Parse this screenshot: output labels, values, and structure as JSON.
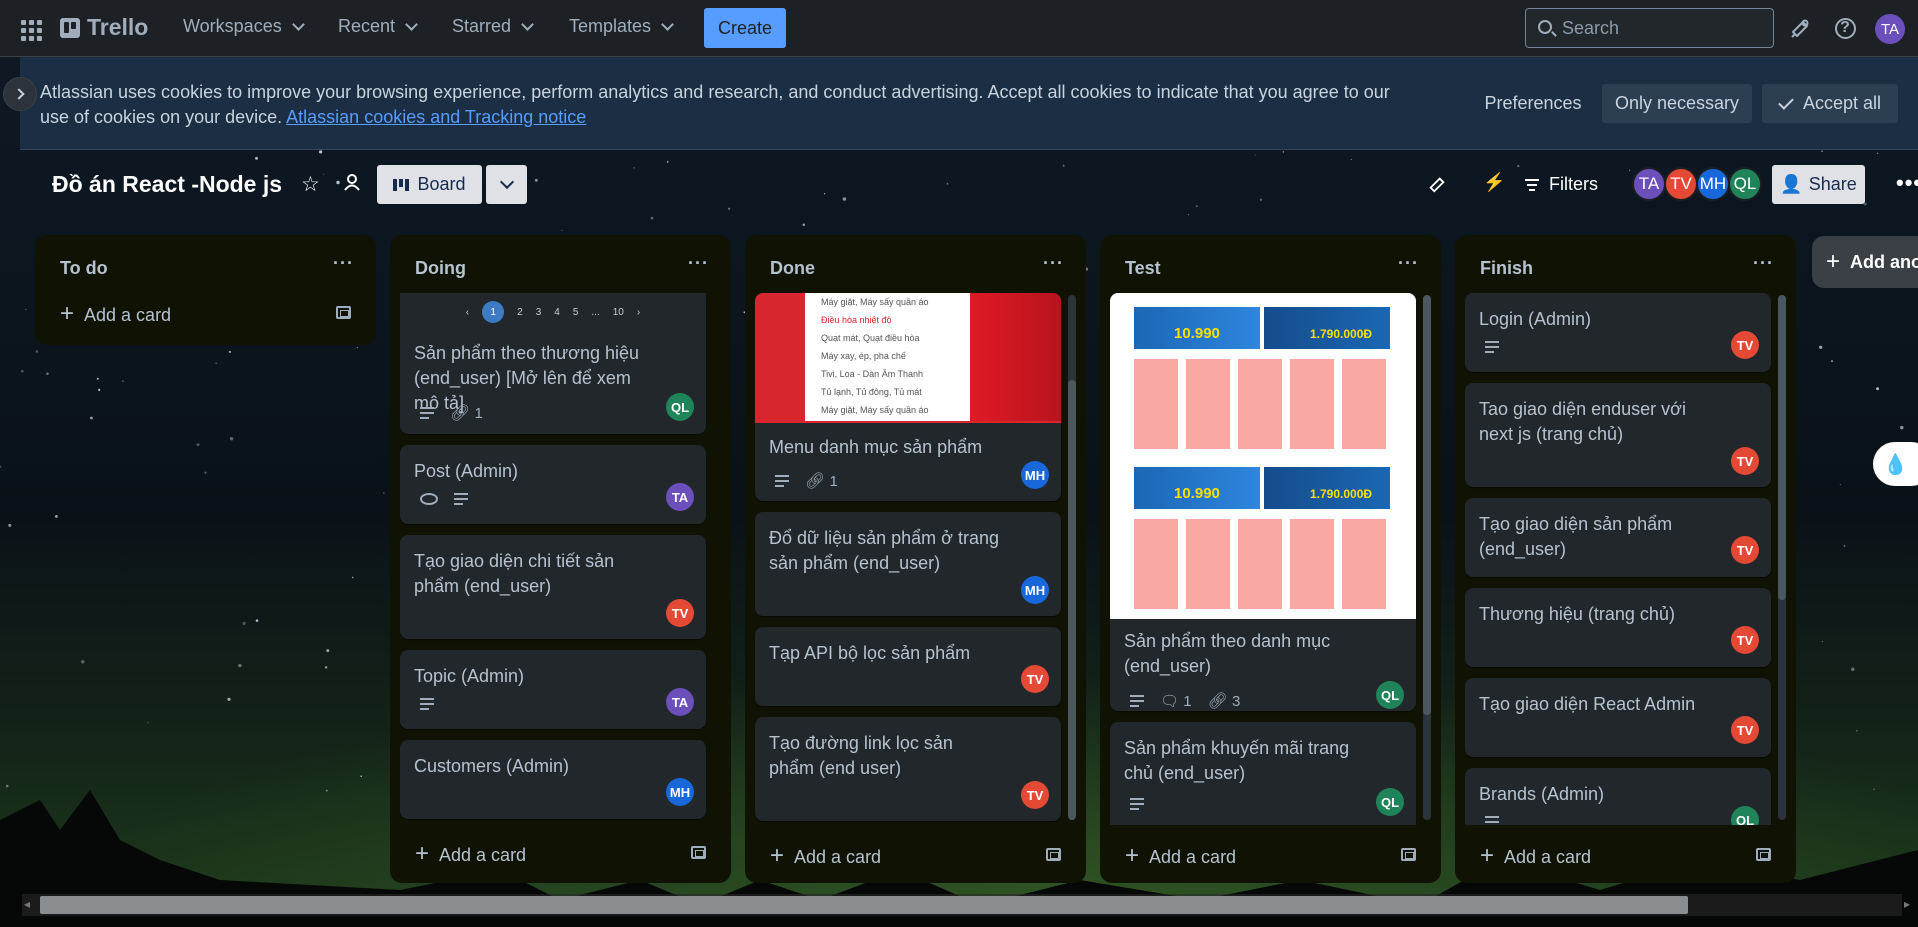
{
  "nav": {
    "logo_text": "Trello",
    "workspaces": "Workspaces",
    "recent": "Recent",
    "starred": "Starred",
    "templates": "Templates",
    "create": "Create",
    "search_placeholder": "Search",
    "user_initials": "TA"
  },
  "cookie_banner": {
    "text": "Atlassian uses cookies to improve your browsing experience, perform analytics and research, and conduct advertising. Accept all cookies to indicate that you agree to our use of cookies on your device.",
    "link": "Atlassian cookies and Tracking notice",
    "preferences": "Preferences",
    "only_necessary": "Only necessary",
    "accept_all": "Accept all"
  },
  "board": {
    "title": "Đồ án React -Node js",
    "view": "Board",
    "filters": "Filters",
    "share": "Share",
    "members": [
      {
        "initials": "TA",
        "color": "#6b4fbb"
      },
      {
        "initials": "TV",
        "color": "#e34935"
      },
      {
        "initials": "MH",
        "color": "#1868db"
      },
      {
        "initials": "QL",
        "color": "#1f845a"
      }
    ],
    "add_another_list": "Add another list"
  },
  "lists": [
    {
      "title": "To do",
      "add_card": "Add a card",
      "cards": []
    },
    {
      "title": "Doing",
      "add_card": "Add a card",
      "pager": [
        "‹",
        "1",
        "2",
        "3",
        "4",
        "5",
        "...",
        "10",
        "›"
      ],
      "cards": [
        {
          "title": "Sản phẩm theo thương hiệu (end_user) [Mở lên để xem mô tả]",
          "description": true,
          "attachments": "1",
          "member": "QL"
        },
        {
          "title": "Post (Admin)",
          "watching": true,
          "description": true,
          "member": "TA"
        },
        {
          "title": "Tạo giao diện chi tiết sản phẩm (end_user)",
          "member": "TV"
        },
        {
          "title": "Topic (Admin)",
          "description": true,
          "member": "TA"
        },
        {
          "title": "Customers (Admin)",
          "member": "MH"
        }
      ]
    },
    {
      "title": "Done",
      "add_card": "Add a card",
      "cover_menu": [
        "Máy giặt, Máy sấy quần áo",
        "Điều hòa nhiệt độ",
        "Quạt mát, Quạt điều hòa",
        "Máy xay, ép, pha chế",
        "Tivi, Loa - Dàn Âm Thanh",
        "Tủ lạnh, Tủ đông, Tủ mát",
        "Máy giặt, Máy sấy quần áo"
      ],
      "cards": [
        {
          "title": "Menu danh mục sản phẩm",
          "description": true,
          "attachments": "1",
          "member": "MH"
        },
        {
          "title": "Đổ dữ liệu sản phẩm ở trang sản phẩm (end_user)",
          "member": "MH"
        },
        {
          "title": "Tạp API bộ lọc sản phẩm",
          "member": "TV"
        },
        {
          "title": "Tạo đường link lọc sản phẩm (end user)",
          "member": "TV"
        }
      ]
    },
    {
      "title": "Test",
      "add_card": "Add a card",
      "cover_prices": [
        "10.990",
        "1.790.000Đ"
      ],
      "cards": [
        {
          "title": "Sản phẩm theo danh mục (end_user)",
          "description": true,
          "comments": "1",
          "attachments": "3",
          "member": "QL"
        },
        {
          "title": "Sản phẩm khuyến mãi trang chủ (end_user)",
          "description": true,
          "member": "QL"
        }
      ]
    },
    {
      "title": "Finish",
      "add_card": "Add a card",
      "cards": [
        {
          "title": "Login (Admin)",
          "description": true,
          "member": "TV"
        },
        {
          "title": "Tao giao diện enduser với next js (trang chủ)",
          "member": "TV"
        },
        {
          "title": "Tạo giao diện sản phẩm (end_user)",
          "member": "TV"
        },
        {
          "title": "Thương hiệu (trang chủ)",
          "member": "TV"
        },
        {
          "title": "Tạo giao diện React Admin",
          "member": "TV"
        },
        {
          "title": "Brands (Admin)",
          "description": true,
          "member": "QL"
        }
      ]
    }
  ],
  "member_colors": {
    "TA": "#6b4fbb",
    "TV": "#e34935",
    "MH": "#1868db",
    "QL": "#1f845a"
  }
}
